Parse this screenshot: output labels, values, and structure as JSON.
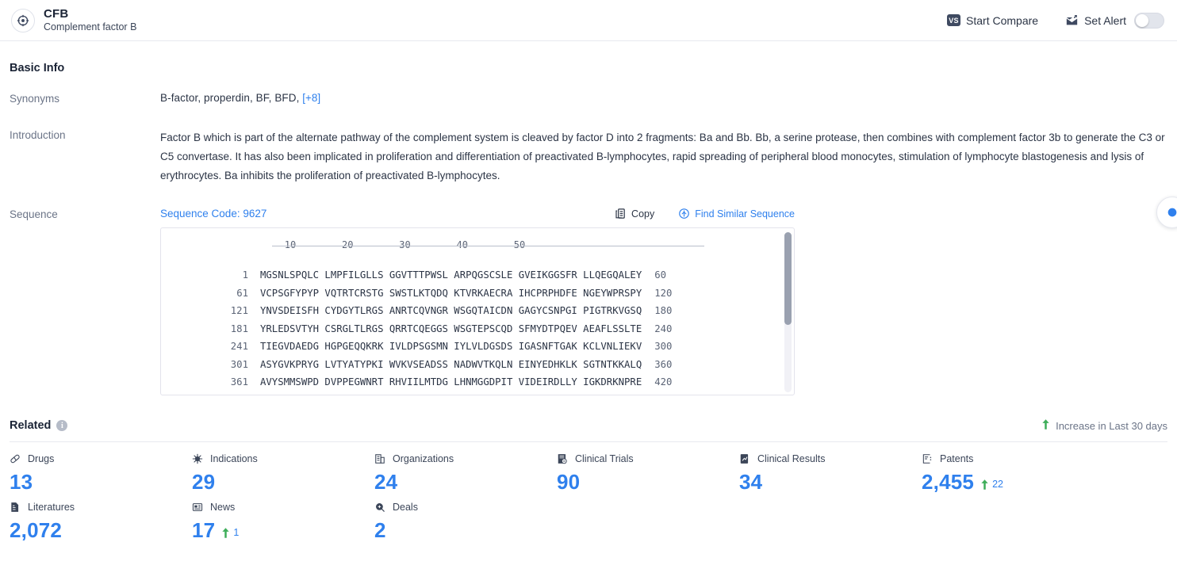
{
  "header": {
    "icon": "target-icon",
    "title": "CFB",
    "subtitle": "Complement factor B",
    "compare_badge": "VS",
    "compare_label": "Start Compare",
    "alert_icon": "mail-alert-icon",
    "alert_label": "Set Alert",
    "alert_toggle_state": "off"
  },
  "basic_info": {
    "section_title": "Basic Info",
    "synonyms_label": "Synonyms",
    "synonyms_value": "B-factor, properdin,  BF,  BFD,",
    "synonyms_more": "[+8]",
    "introduction_label": "Introduction",
    "introduction_text": "Factor B which is part of the alternate pathway of the complement system is cleaved by factor D into 2 fragments: Ba and Bb. Bb, a serine protease, then combines with complement factor 3b to generate the C3 or C5 convertase. It has also been implicated in proliferation and differentiation of preactivated B-lymphocytes, rapid spreading of peripheral blood monocytes, stimulation of lymphocyte blastogenesis and lysis of erythrocytes. Ba inhibits the proliferation of preactivated B-lymphocytes.",
    "sequence_label": "Sequence"
  },
  "sequence": {
    "code_label": "Sequence Code: 9627",
    "copy_icon": "copy-icon",
    "copy_label": "Copy",
    "find_similar_icon": "find-similar-icon",
    "find_similar_label": "Find Similar Sequence",
    "ruler": "        10        20        30        40        50",
    "rows": [
      {
        "start": "1",
        "seq": "MGSNLSPQLC LMPFILGLLS GGVTTTPWSL ARPQGSCSLE GVEIKGGSFR LLQEGQALEY",
        "end": "60"
      },
      {
        "start": "61",
        "seq": "VCPSGFYPYP VQTRTCRSTG SWSTLKTQDQ KTVRKAECRA IHCPRPHDFE NGEYWPRSPY",
        "end": "120"
      },
      {
        "start": "121",
        "seq": "YNVSDEISFH CYDGYTLRGS ANRTCQVNGR WSGQTAICDN GAGYCSNPGI PIGTRKVGSQ",
        "end": "180"
      },
      {
        "start": "181",
        "seq": "YRLEDSVTYH CSRGLTLRGS QRRTCQEGGS WSGTEPSCQD SFMYDTPQEV AEAFLSSLTE",
        "end": "240"
      },
      {
        "start": "241",
        "seq": "TIEGVDAEDG HGPGEQQKRK IVLDPSGSMN IYLVLDGSDS IGASNFTGAK KCLVNLIEKV",
        "end": "300"
      },
      {
        "start": "301",
        "seq": "ASYGVKPRYG LVTYATYPKI WVKVSEADSS NADWVTKQLN EINYEDHKLK SGTNTKKALQ",
        "end": "360"
      },
      {
        "start": "361",
        "seq": "AVYSMMSWPD DVPPEGWNRT RHVIILMTDG LHNMGGDPIT VIDEIRDLLY IGKDRKNPRE",
        "end": "420"
      }
    ]
  },
  "related": {
    "title": "Related",
    "info_icon": "info-icon",
    "info_glyph": "i",
    "legend_icon": "arrow-up-icon",
    "legend_label": "Increase in Last 30 days",
    "stats": [
      {
        "icon": "pill-icon",
        "label": "Drugs",
        "value": "13",
        "delta": ""
      },
      {
        "icon": "virus-icon",
        "label": "Indications",
        "value": "29",
        "delta": ""
      },
      {
        "icon": "building-icon",
        "label": "Organizations",
        "value": "24",
        "delta": ""
      },
      {
        "icon": "clinical-trial-icon",
        "label": "Clinical Trials",
        "value": "90",
        "delta": ""
      },
      {
        "icon": "clinical-result-icon",
        "label": "Clinical Results",
        "value": "34",
        "delta": ""
      },
      {
        "icon": "patent-icon",
        "label": "Patents",
        "value": "2,455",
        "delta": "22"
      },
      {
        "icon": "literature-icon",
        "label": "Literatures",
        "value": "2,072",
        "delta": ""
      },
      {
        "icon": "news-icon",
        "label": "News",
        "value": "17",
        "delta": "1"
      },
      {
        "icon": "deal-icon",
        "label": "Deals",
        "value": "2",
        "delta": ""
      }
    ]
  },
  "colors": {
    "accent_blue": "#2f80ed",
    "text_dark": "#1b2436",
    "text_muted": "#6b7487",
    "increase_green": "#3eae5a",
    "border": "#e8e9ef"
  }
}
